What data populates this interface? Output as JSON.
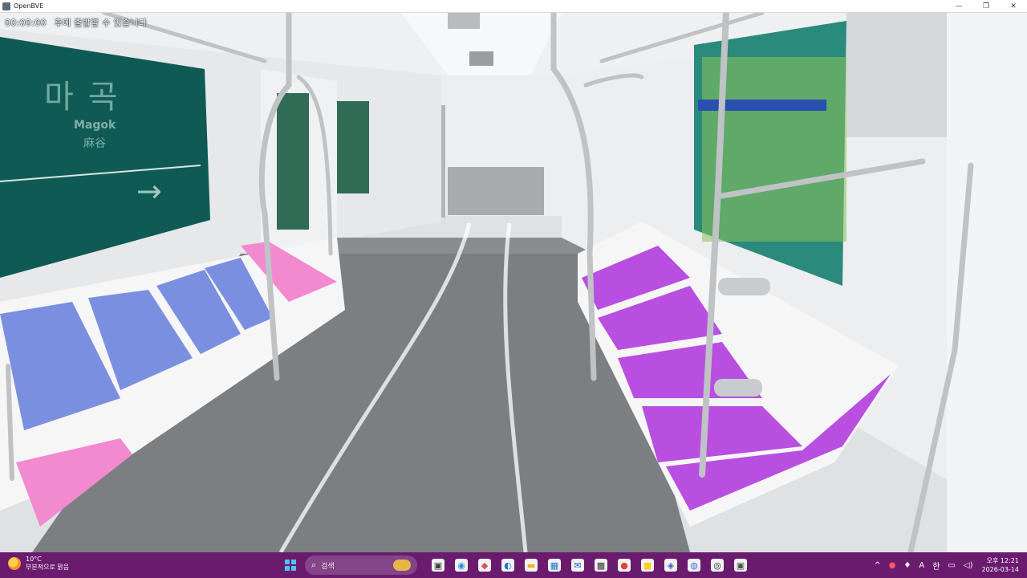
{
  "window": {
    "title": "OpenBVE",
    "minimize_glyph": "—",
    "maximize_glyph": "❐",
    "close_glyph": "✕"
  },
  "sim": {
    "overlay_time": "00:00:00",
    "overlay_message": "후에 출발할 수 있습니다",
    "station_sign_ko": "마곡",
    "station_sign_en": "Magok",
    "station_sign_sub": "麻谷"
  },
  "taskbar": {
    "weather_temp": "10°C",
    "weather_desc": "부분적으로 맑음",
    "search_placeholder": "검색",
    "apps": [
      {
        "name": "task-view",
        "glyph": "▣",
        "color": "#3a3a3a"
      },
      {
        "name": "copilot",
        "glyph": "◉",
        "color": "#1f8fd6"
      },
      {
        "name": "app-multicolor",
        "glyph": "◆",
        "color": "#d9534f"
      },
      {
        "name": "edge",
        "glyph": "◐",
        "color": "#0a7cd1"
      },
      {
        "name": "file-explorer",
        "glyph": "▬",
        "color": "#f2b01e"
      },
      {
        "name": "store",
        "glyph": "▦",
        "color": "#2b6fd6"
      },
      {
        "name": "outlook",
        "glyph": "✉",
        "color": "#0f64c0"
      },
      {
        "name": "photos",
        "glyph": "▩",
        "color": "#3a3a3a"
      },
      {
        "name": "chrome",
        "glyph": "●",
        "color": "#db4437"
      },
      {
        "name": "kakaotalk",
        "glyph": "■",
        "color": "#f7d117"
      },
      {
        "name": "teams",
        "glyph": "◈",
        "color": "#5059c9"
      },
      {
        "name": "discord",
        "glyph": "◍",
        "color": "#5865f2"
      },
      {
        "name": "obs",
        "glyph": "◎",
        "color": "#222222"
      },
      {
        "name": "openbve",
        "glyph": "▣",
        "color": "#4a4a4a"
      }
    ],
    "tray": {
      "chevron": "^",
      "ime_mode": "A",
      "ime_lang": "한",
      "time": "오후 12:21",
      "date": "2026-03-14"
    }
  },
  "colors": {
    "taskbar_bg": "#6a1b6e",
    "seat_blue": "#7b8fe0",
    "seat_pink": "#f28ad0",
    "seat_purple": "#b84fe0",
    "station_sign": "#0f5a55"
  }
}
